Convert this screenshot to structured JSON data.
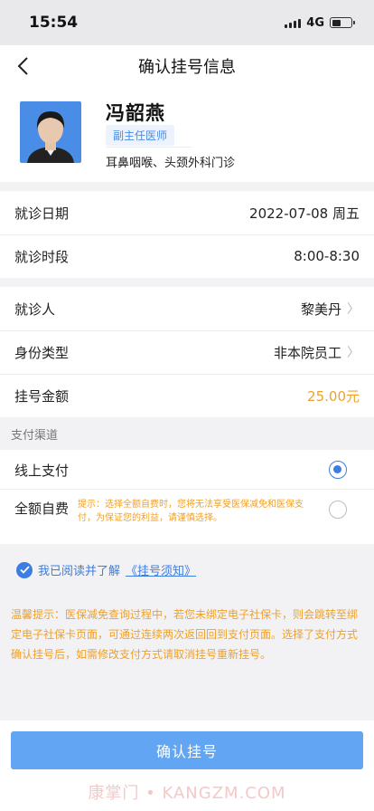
{
  "status_bar": {
    "time": "15:54",
    "network": "4G"
  },
  "nav": {
    "title": "确认挂号信息"
  },
  "doctor": {
    "name": "冯韶燕",
    "title": "副主任医师",
    "department": "耳鼻咽喉、头颈外科门诊"
  },
  "visit": {
    "date_label": "就诊日期",
    "date_value": "2022-07-08 周五",
    "time_label": "就诊时段",
    "time_value": "8:00-8:30"
  },
  "patient": {
    "patient_label": "就诊人",
    "patient_value": "黎美丹",
    "identity_label": "身份类型",
    "identity_value": "非本院员工",
    "fee_label": "挂号金额",
    "fee_value": "25.00元"
  },
  "payment": {
    "header": "支付渠道",
    "online_label": "线上支付",
    "online_selected": true,
    "full_label": "全额自费",
    "full_selected": false,
    "full_note": "提示：选择全额自费时，您将无法享受医保减免和医保支付，为保证您的利益，请谨慎选择。"
  },
  "agreement": {
    "text": "我已阅读并了解",
    "link": "《挂号须知》",
    "checked": true
  },
  "tips": {
    "text": "温馨提示：医保减免查询过程中，若您未绑定电子社保卡，则会跳转至绑定电子社保卡页面，可通过连续两次返回回到支付页面。选择了支付方式确认挂号后，如需修改支付方式请取消挂号重新挂号。"
  },
  "confirm": {
    "label": "确认挂号"
  },
  "watermark": {
    "text": "康掌门 • KANGZM.COM"
  },
  "colors": {
    "accent": "#3b7de3",
    "button": "#62a5f2",
    "warning": "#f0a028",
    "avatar_bg": "#4a8de6"
  },
  "icons": {
    "back": "chevron-left-icon",
    "row_arrow": "chevron-right-icon",
    "check": "check-circle-icon"
  }
}
